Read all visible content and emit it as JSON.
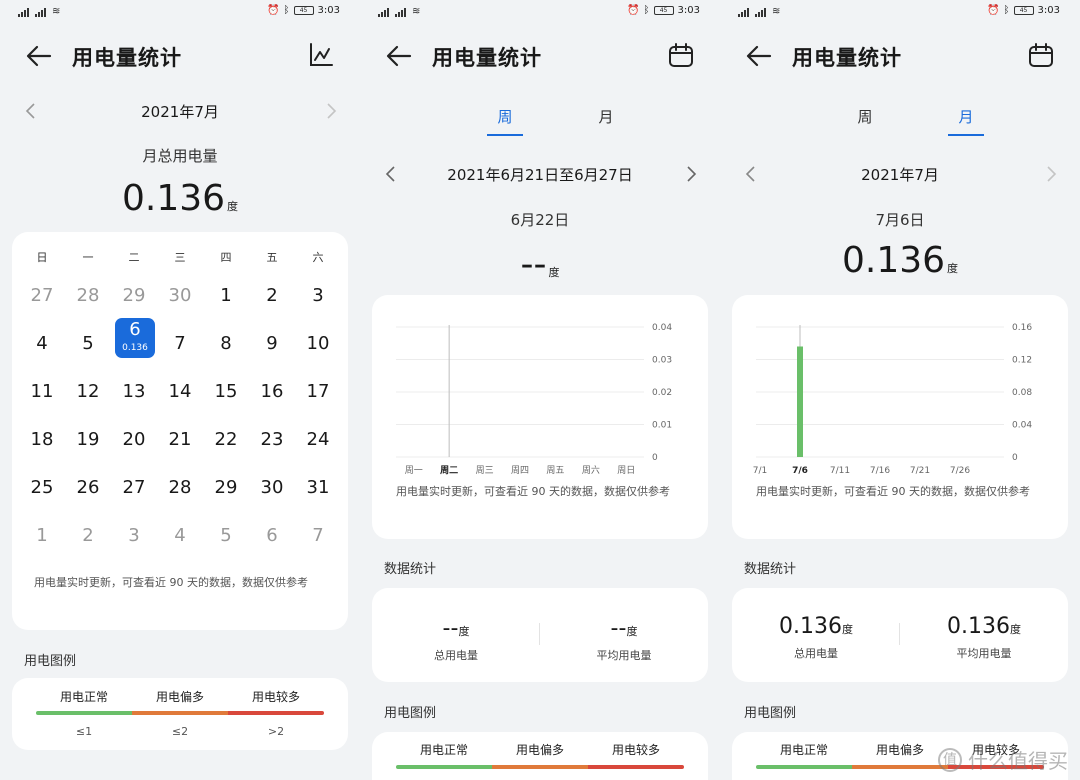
{
  "status": {
    "time": "3:03",
    "signal_label": "4G",
    "battery": "45"
  },
  "title": "用电量统计",
  "panel1": {
    "month": "2021年7月",
    "summary_label": "月总用电量",
    "summary_value": "0.136",
    "unit": "度",
    "weekdays": [
      "日",
      "一",
      "二",
      "三",
      "四",
      "五",
      "六"
    ],
    "weeks": [
      [
        "27",
        "28",
        "29",
        "30",
        "1",
        "2",
        "3"
      ],
      [
        "4",
        "5",
        "6",
        "7",
        "8",
        "9",
        "10"
      ],
      [
        "11",
        "12",
        "13",
        "14",
        "15",
        "16",
        "17"
      ],
      [
        "18",
        "19",
        "20",
        "21",
        "22",
        "23",
        "24"
      ],
      [
        "25",
        "26",
        "27",
        "28",
        "29",
        "30",
        "31"
      ],
      [
        "1",
        "2",
        "3",
        "4",
        "5",
        "6",
        "7"
      ]
    ],
    "selected_value": "0.136",
    "note": "用电量实时更新，可查看近 90 天的数据，数据仅供参考",
    "legend_title": "用电图例",
    "legend": {
      "labels": [
        "用电正常",
        "用电偏多",
        "用电较多"
      ],
      "values": [
        "≤1",
        "≤2",
        ">2"
      ],
      "colors": [
        "#6abf69",
        "#e07a3a",
        "#d9483b"
      ]
    }
  },
  "panel2": {
    "tabs": [
      "周",
      "月"
    ],
    "active_tab": "周",
    "range": "2021年6月21日至6月27日",
    "day_label": "6月22日",
    "day_value": "--",
    "unit": "度",
    "note": "用电量实时更新，可查看近 90 天的数据，数据仅供参考",
    "stats_title": "数据统计",
    "stats": [
      {
        "value": "--",
        "label": "总用电量"
      },
      {
        "value": "--",
        "label": "平均用电量"
      }
    ],
    "legend_title": "用电图例",
    "legend_labels": [
      "用电正常",
      "用电偏多",
      "用电较多"
    ]
  },
  "panel3": {
    "tabs": [
      "周",
      "月"
    ],
    "active_tab": "月",
    "month": "2021年7月",
    "day_label": "7月6日",
    "day_value": "0.136",
    "unit": "度",
    "note": "用电量实时更新，可查看近 90 天的数据，数据仅供参考",
    "stats_title": "数据统计",
    "stats": [
      {
        "value": "0.136",
        "label": "总用电量"
      },
      {
        "value": "0.136",
        "label": "平均用电量"
      }
    ],
    "legend_title": "用电图例",
    "legend_labels": [
      "用电正常",
      "用电偏多",
      "用电较多"
    ]
  },
  "watermark": "什么值得买",
  "chart_data": [
    {
      "type": "bar",
      "categories": [
        "周一",
        "周二",
        "周三",
        "周四",
        "周五",
        "周六",
        "周日"
      ],
      "values": [
        0,
        0,
        0,
        0,
        0,
        0,
        0
      ],
      "yticks": [
        0,
        0.01,
        0.02,
        0.03,
        0.04
      ],
      "ylim": [
        0,
        0.04
      ],
      "selected_category": "周二",
      "grid": true,
      "y_axis_side": "right"
    },
    {
      "type": "bar",
      "x_tick_labels": [
        "7/1",
        "7/6",
        "7/11",
        "7/16",
        "7/21",
        "7/26"
      ],
      "days": 31,
      "x_start_day": 1,
      "values": [
        {
          "day": 6,
          "value": 0.136
        }
      ],
      "yticks": [
        0,
        0.04,
        0.08,
        0.12,
        0.16
      ],
      "ylim": [
        0,
        0.16
      ],
      "selected_day": 6,
      "grid": true,
      "y_axis_side": "right",
      "bar_color": "#6abf69"
    }
  ]
}
